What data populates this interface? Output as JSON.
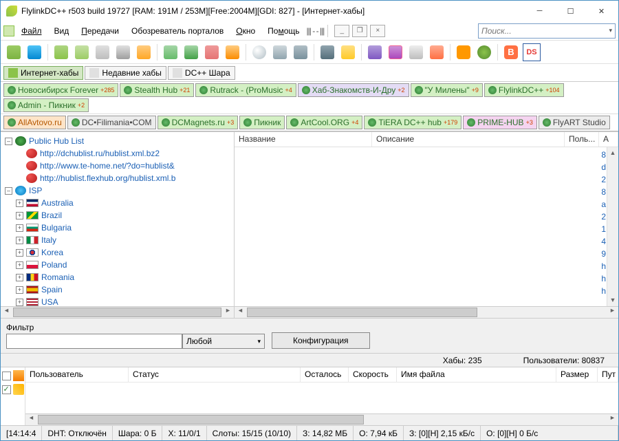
{
  "title": "FlylinkDC++ r503 build 19727 [RAM: 191M / 253M][Free:2004M][GDI: 827] - [Интернет-хабы]",
  "menu": {
    "file": "Файл",
    "view": "Вид",
    "transfers": "Передачи",
    "portals": "Обозреватель порталов",
    "window": "Окно",
    "help": "Помощь"
  },
  "search": {
    "placeholder": "Поиск..."
  },
  "main_tabs": [
    {
      "label": "Интернет-хабы",
      "active": true
    },
    {
      "label": "Недавние хабы"
    },
    {
      "label": "DC++ Шара"
    }
  ],
  "hub_row1": [
    {
      "label": "Новосибирск Forever",
      "badge": "+285",
      "cls": "lime"
    },
    {
      "label": "Stealth Hub",
      "badge": "+21",
      "cls": "lime"
    },
    {
      "label": "Rutrack - (ProMusic",
      "badge": "+4",
      "cls": "lime"
    },
    {
      "label": "Хаб-Знакомств-И-Дру",
      "badge": "+2",
      "cls": "lav"
    },
    {
      "label": "\"У Милены\"",
      "badge": "+9",
      "cls": "lime"
    },
    {
      "label": "FlylinkDC++",
      "badge": "+104",
      "cls": "lime"
    },
    {
      "label": "Admin - Пикник",
      "badge": "+2",
      "cls": "lime"
    }
  ],
  "hub_row2": [
    {
      "label": "AllAvtovo.ru",
      "badge": "",
      "cls": "orange"
    },
    {
      "label": "DC•Filimania•COM",
      "badge": "",
      "cls": "gray"
    },
    {
      "label": "DCMagnets.ru",
      "badge": "+3",
      "cls": "lime"
    },
    {
      "label": "Пикник",
      "badge": "",
      "cls": "lime"
    },
    {
      "label": "ArtCool.ORG",
      "badge": "+4",
      "cls": "lime"
    },
    {
      "label": "TiERA DC++ hub",
      "badge": "+179",
      "cls": "lime"
    },
    {
      "label": "PRIME-HUB",
      "badge": "+3",
      "cls": "mag"
    },
    {
      "label": "FlyART Studio",
      "badge": "",
      "cls": "gray"
    }
  ],
  "tree": {
    "root": "Public Hub List",
    "urls": [
      "http://dchublist.ru/hublist.xml.bz2",
      "http://www.te-home.net/?do=hublist&",
      "http://hublist.flexhub.org/hublist.xml.b"
    ],
    "isp_label": "ISP",
    "countries": [
      {
        "name": "Australia",
        "flag": "linear-gradient(180deg,#002868 33%,#fff 33% 66%,#bf0a30 66%)"
      },
      {
        "name": "Brazil",
        "flag": "linear-gradient(135deg,#009739 40%,#fedd00 40% 60%,#009739 60%)"
      },
      {
        "name": "Bulgaria",
        "flag": "linear-gradient(180deg,#fff 33%,#00966e 33% 66%,#d62612 66%)"
      },
      {
        "name": "Italy",
        "flag": "linear-gradient(90deg,#008c45 33%,#fff 33% 66%,#cd212a 66%)"
      },
      {
        "name": "Korea",
        "flag": "radial-gradient(circle,#cd2e3a 30%,#0047a0 30% 45%,#fff 45%)"
      },
      {
        "name": "Poland",
        "flag": "linear-gradient(180deg,#fff 50%,#dc143c 50%)"
      },
      {
        "name": "Romania",
        "flag": "linear-gradient(90deg,#002b7f 33%,#fcd116 33% 66%,#ce1126 66%)"
      },
      {
        "name": "Spain",
        "flag": "linear-gradient(180deg,#aa151b 25%,#f1bf00 25% 75%,#aa151b 75%)"
      },
      {
        "name": "USA",
        "flag": "repeating-linear-gradient(180deg,#b22234 0 2px,#fff 2px 4px)"
      }
    ]
  },
  "list_cols": {
    "name": "Название",
    "desc": "Описание",
    "users": "Поль...",
    "a": "A"
  },
  "side_letters": [
    "8",
    "d",
    "2",
    "8",
    "a",
    "2",
    "1",
    "4",
    "9",
    "h",
    "h",
    "h"
  ],
  "filter": {
    "label": "Фильтр",
    "any": "Любой",
    "config": "Конфигурация"
  },
  "stats": {
    "hubs_label": "Хабы:",
    "hubs": "235",
    "users_label": "Пользователи:",
    "users": "80837"
  },
  "bottom_cols": {
    "user": "Пользователь",
    "status": "Статус",
    "left": "Осталось",
    "speed": "Скорость",
    "file": "Имя файла",
    "size": "Размер",
    "path": "Пут"
  },
  "status": {
    "time": "[14:14:4",
    "dht": "DHT: Отключён",
    "share": "Шара: 0 Б",
    "x": "X: 11/0/1",
    "slots": "Слоты: 15/15 (10/10)",
    "z": "З: 14,82 МБ",
    "o": "О: 7,94 кБ",
    "z2": "З: [0][H] 2,15 кБ/с",
    "o2": "О: [0][H] 0 Б/с"
  }
}
